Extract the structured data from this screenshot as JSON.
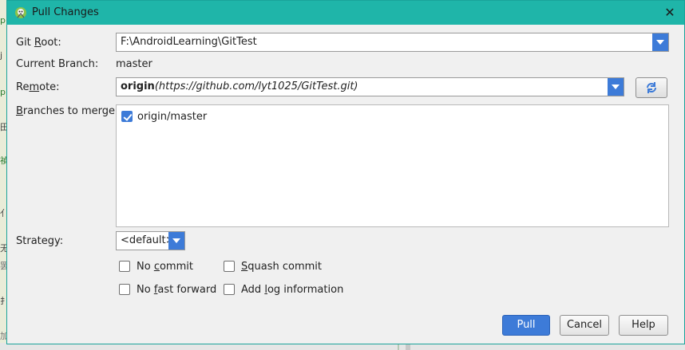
{
  "dialog": {
    "title": "Pull Changes",
    "close_label": "✕"
  },
  "form": {
    "git_root": {
      "label_pre": "Git ",
      "label_u": "R",
      "label_post": "oot:",
      "value": "F:\\AndroidLearning\\GitTest"
    },
    "current_branch": {
      "label": "Current Branch:",
      "value": "master"
    },
    "remote": {
      "label_pre": "Re",
      "label_u": "m",
      "label_post": "ote:",
      "value_bold": "origin",
      "value_rest": "(https://github.com/lyt1025/GitTest.git)"
    },
    "branches": {
      "label_pre": "",
      "label_u": "B",
      "label_post": "ranches to merge:",
      "items": [
        {
          "label": "origin/master",
          "checked": true
        }
      ]
    },
    "strategy": {
      "label": "Strategy:",
      "value": "<default>"
    }
  },
  "options": {
    "no_commit": {
      "pre": "No ",
      "u": "c",
      "post": "ommit",
      "checked": false
    },
    "squash_commit": {
      "pre": "",
      "u": "S",
      "post": "quash commit",
      "checked": false
    },
    "no_fast_forward": {
      "pre": "No ",
      "u": "f",
      "post": "ast forward",
      "checked": false
    },
    "add_log": {
      "pre": "Add ",
      "u": "l",
      "post": "og information",
      "checked": false
    }
  },
  "buttons": {
    "pull": "Pull",
    "cancel": "Cancel",
    "help": "Help"
  },
  "colors": {
    "title_bar": "#1fb5a9",
    "accent": "#3d7bd8"
  },
  "icons": {
    "app": "android-studio-icon",
    "refresh": "refresh-icon",
    "dropdown": "chevron-down-icon",
    "close": "close-icon"
  }
}
